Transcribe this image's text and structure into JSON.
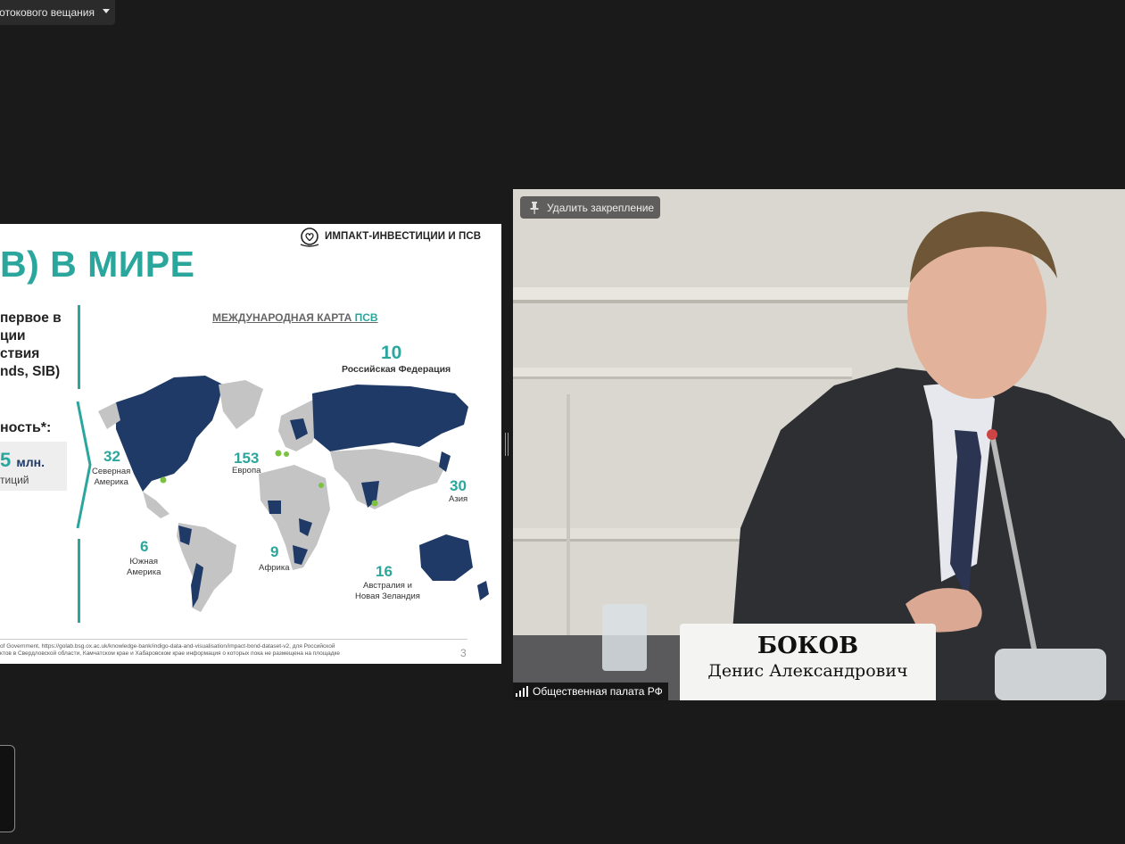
{
  "stream": {
    "dropdown_label": "потокового вещания"
  },
  "slide": {
    "brand": "ИМПАКТ-ИНВЕСТИЦИИ И ПСВ",
    "title": "В) В МИРЕ",
    "left_text": "первое в\nции\nствия\nnds, SIB)",
    "left_sub": "ность*:",
    "amount": "5",
    "amount_unit": "млн.",
    "amount_sub": "тиций",
    "map_title_prefix": "МЕЖДУНАРОДНАЯ КАРТА ",
    "map_title_accent": "ПСВ",
    "regions": [
      {
        "count": "10",
        "label": "Российская Федерация"
      },
      {
        "count": "32",
        "label": "Северная\nАмерика"
      },
      {
        "count": "153",
        "label": "Европа"
      },
      {
        "count": "30",
        "label": "Азия"
      },
      {
        "count": "6",
        "label": "Южная\nАмерика"
      },
      {
        "count": "9",
        "label": "Африка"
      },
      {
        "count": "16",
        "label": "Австралия и\nНовая Зеландия"
      }
    ],
    "footnote": "of Government, https://golab.bsg.ox.ac.uk/knowledge-bank/indigo-data-and-visualisation/impact-bond-dataset-v2, для Российской\nктов в Свердловской области, Камчатском крае и Хабаровском крае информация о которых пока не размещена на площадке",
    "page_number": "3",
    "colors": {
      "teal": "#2aa69c",
      "navy": "#1f3a66",
      "grey_land": "#c4c4c4"
    }
  },
  "video": {
    "unpin_label": "Удалить закрепление",
    "participant_name": "Общественная палата РФ",
    "plate_last_name": "БОКОВ",
    "plate_first_name": "Денис Александрович"
  }
}
